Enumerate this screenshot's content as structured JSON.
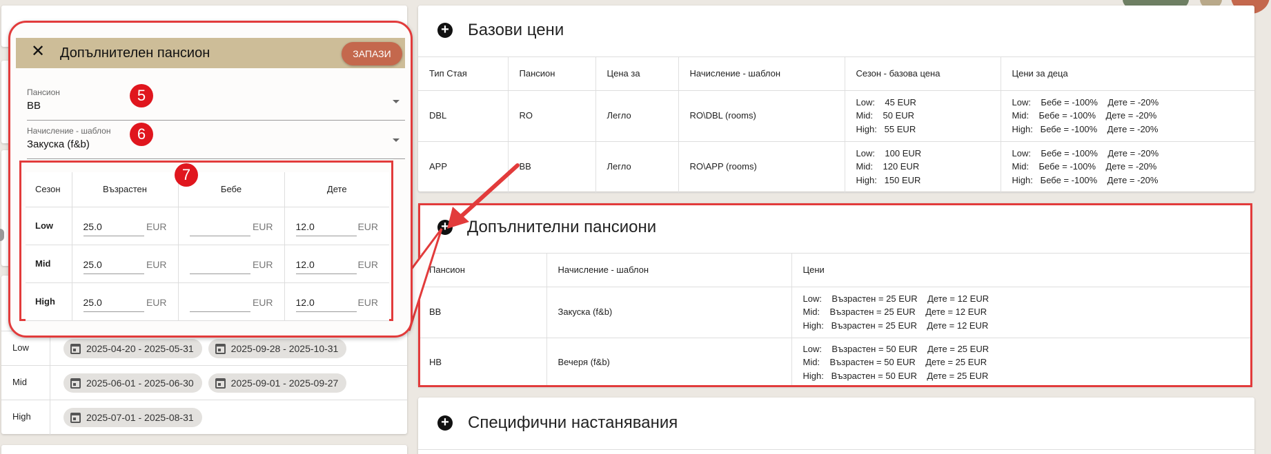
{
  "colors": {
    "header_bg": "#cdbd98",
    "save_btn": "#c4684d",
    "highlight": "#e23b3b",
    "badge": "#e0161e"
  },
  "base_prices": {
    "title": "Базови цени",
    "headers": [
      "Тип Стая",
      "Пансион",
      "Цена за",
      "Начисление - шаблон",
      "Сезон - базова цена",
      "Цени за деца"
    ],
    "rows": [
      {
        "room": "DBL",
        "board": "RO",
        "per": "Легло",
        "template": "RO\\DBL (rooms)",
        "season": "Low:    45 EUR\nMid:    50 EUR\nHigh:   55 EUR",
        "kids": "Low:    Бебе = -100%    Дете = -20%\nMid:    Бебе = -100%    Дете = -20%\nHigh:   Бебе = -100%    Дете = -20%"
      },
      {
        "room": "APP",
        "board": "BB",
        "per": "Легло",
        "template": "RO\\APP (rooms)",
        "season": "Low:    100 EUR\nMid:    120 EUR\nHigh:   150 EUR",
        "kids": "Low:    Бебе = -100%    Дете = -20%\nMid:    Бебе = -100%    Дете = -20%\nHigh:   Бебе = -100%    Дете = -20%"
      }
    ]
  },
  "extra_boards": {
    "title": "Допълнителни пансиони",
    "headers": [
      "Пансион",
      "Начисление - шаблон",
      "Цени"
    ],
    "rows": [
      {
        "board": "BB",
        "template": "Закуска (f&b)",
        "prices": "Low:    Възрастен = 25 EUR    Дете = 12 EUR\nMid:    Възрастен = 25 EUR    Дете = 12 EUR\nHigh:   Възрастен = 25 EUR    Дете = 12 EUR"
      },
      {
        "board": "HB",
        "template": "Вечеря (f&b)",
        "prices": "Low:    Възрастен = 50 EUR    Дете = 25 EUR\nMid:    Възрастен = 50 EUR    Дете = 25 EUR\nHigh:   Възрастен = 50 EUR    Дете = 25 EUR"
      }
    ]
  },
  "specific": {
    "title": "Специфични настанявания"
  },
  "seasons": [
    {
      "name": "Low",
      "ranges": [
        "2025-04-20 - 2025-05-31",
        "2025-09-28 - 2025-10-31"
      ]
    },
    {
      "name": "Mid",
      "ranges": [
        "2025-06-01 - 2025-06-30",
        "2025-09-01 - 2025-09-27"
      ]
    },
    {
      "name": "High",
      "ranges": [
        "2025-07-01 - 2025-08-31"
      ]
    }
  ],
  "dialog": {
    "title": "Допълнителен пансион",
    "save": "ЗАПАЗИ",
    "board_label": "Пансион",
    "board_value": "BB",
    "template_label": "Начисление - шаблон",
    "template_value": "Закуска (f&b)",
    "table_headers": [
      "Сезон",
      "Възрастен",
      "Бебе",
      "Дете"
    ],
    "currency": "EUR",
    "rows": [
      {
        "season": "Low",
        "adult": "25.0",
        "baby": "",
        "child": "12.0"
      },
      {
        "season": "Mid",
        "adult": "25.0",
        "baby": "",
        "child": "12.0"
      },
      {
        "season": "High",
        "adult": "25.0",
        "baby": "",
        "child": "12.0"
      }
    ]
  },
  "badges": [
    "5",
    "6",
    "7"
  ]
}
